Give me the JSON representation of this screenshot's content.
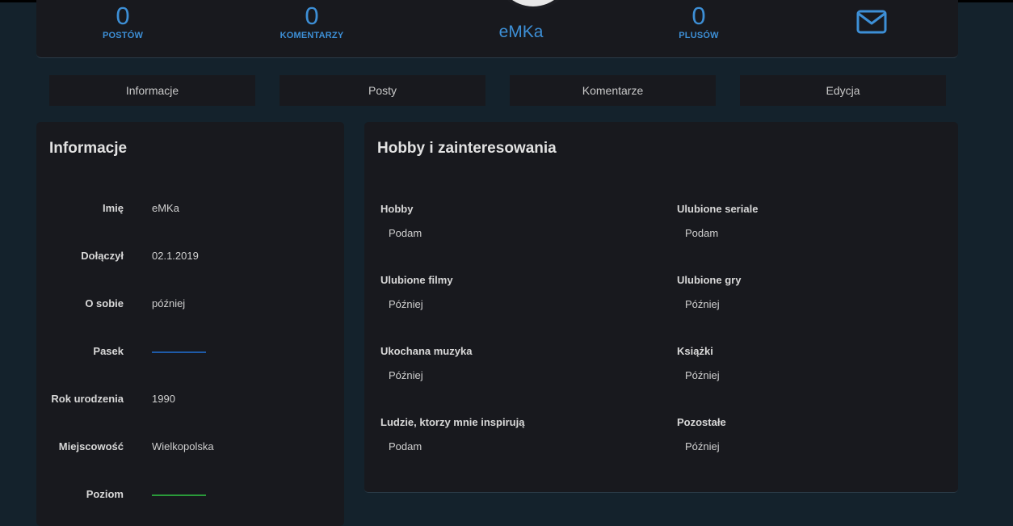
{
  "profile": {
    "username": "eMKa",
    "stats": [
      {
        "value": "0",
        "label": "POSTÓW"
      },
      {
        "value": "0",
        "label": "KOMENTARZY"
      },
      {
        "value": "0",
        "label": "PLUSÓW"
      }
    ]
  },
  "tabs": [
    "Informacje",
    "Posty",
    "Komentarze",
    "Edycja"
  ],
  "info": {
    "title": "Informacje",
    "rows": [
      {
        "key": "Imię",
        "value": "eMKa"
      },
      {
        "key": "Dołączył",
        "value": "02.1.2019"
      },
      {
        "key": "O sobie",
        "value": "później"
      },
      {
        "key": "Pasek",
        "value": ""
      },
      {
        "key": "Rok urodzenia",
        "value": "1990"
      },
      {
        "key": "Miejscowość",
        "value": "Wielkopolska"
      },
      {
        "key": "Poziom",
        "value": ""
      }
    ],
    "bar_colors": {
      "pasek": "#1e5aa8",
      "poziom": "#2a9a3a"
    }
  },
  "hobby": {
    "title": "Hobby i zainteresowania",
    "items": [
      {
        "key": "Hobby",
        "value": "Podam"
      },
      {
        "key": "Ulubione seriale",
        "value": "Podam"
      },
      {
        "key": "Ulubione filmy",
        "value": "Później"
      },
      {
        "key": "Ulubione gry",
        "value": "Później"
      },
      {
        "key": "Ukochana muzyka",
        "value": "Później"
      },
      {
        "key": "Książki",
        "value": "Później"
      },
      {
        "key": "Ludzie, ktorzy mnie inspirują",
        "value": "Podam"
      },
      {
        "key": "Pozostałe",
        "value": "Później"
      }
    ]
  },
  "colors": {
    "accent": "#3d8fd6",
    "card": "#18191e",
    "background": "#14222c"
  }
}
